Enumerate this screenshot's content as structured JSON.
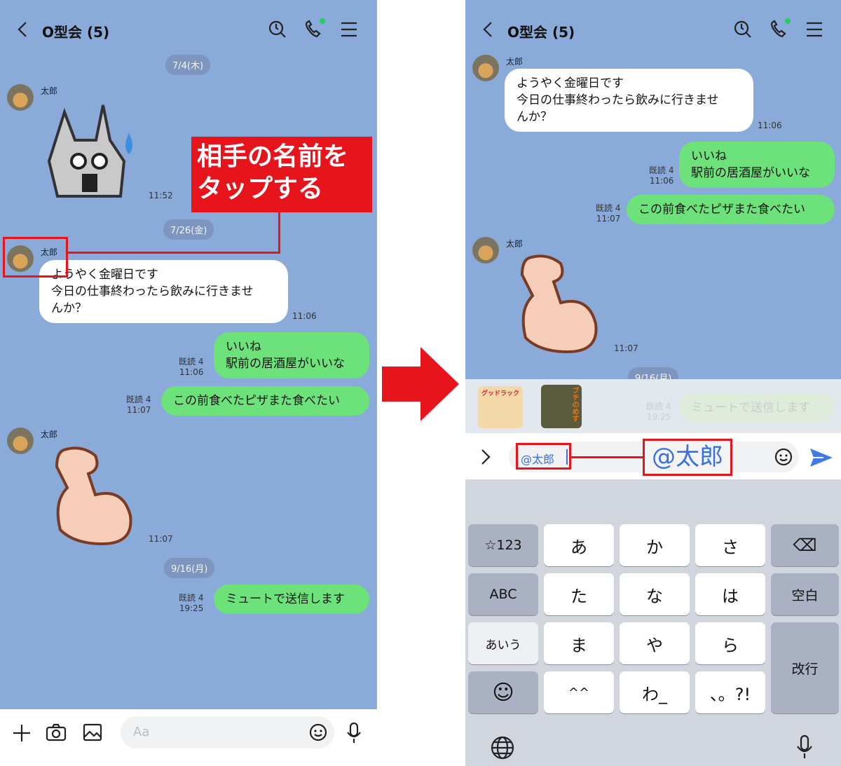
{
  "left": {
    "header": {
      "title": "O型会 (5)"
    },
    "dates": [
      "7/4(木)",
      "7/26(金)",
      "9/16(月)"
    ],
    "messages": [
      {
        "sender": "太郎",
        "type": "sticker",
        "sticker": "rabbit-shocked",
        "time": "11:52"
      },
      {
        "sender": "太郎",
        "type": "text",
        "text": [
          "ようやく金曜日です",
          "今日の仕事終わったら飲みに行きませ",
          "んか？"
        ],
        "time": "11:06"
      },
      {
        "type": "text",
        "own": true,
        "read": "既読 4",
        "text": [
          "いいね",
          "駅前の居酒屋がいいな"
        ],
        "time": "11:06"
      },
      {
        "type": "text",
        "own": true,
        "read": "既読 4",
        "text": [
          "この前食べたピザまた食べたい"
        ],
        "time": "11:07"
      },
      {
        "sender": "太郎",
        "type": "sticker",
        "sticker": "flexed-bicep",
        "time": "11:07"
      },
      {
        "type": "text",
        "own": true,
        "read": "既読 4",
        "text": [
          "ミュートで送信します"
        ],
        "time": "19:25"
      }
    ],
    "input": {
      "placeholder": "Aa"
    },
    "annotation": [
      "相手の名前を",
      "タップする"
    ]
  },
  "right": {
    "header": {
      "title": "O型会 (5)"
    },
    "messages": [
      {
        "sender": "太郎",
        "text": [
          "ようやく金曜日です",
          "今日の仕事終わったら飲みに行きませ",
          "んか？"
        ],
        "time": "11:06"
      },
      {
        "own": true,
        "read": "既読 4",
        "text": [
          "いいね",
          "駅前の居酒屋がいいな"
        ],
        "time": "11:06"
      },
      {
        "own": true,
        "read": "既読 4",
        "text": [
          "この前食べたピザまた食べたい"
        ],
        "time": "11:07"
      },
      {
        "sender": "太郎",
        "sticker": "flexed-bicep",
        "time": "11:07"
      }
    ],
    "date": "9/16(月)",
    "faded_message": {
      "read": "既読 4",
      "time": "19:25",
      "text": "ミュートで送信します"
    },
    "sticker_suggestions": [
      "グッドラック",
      "ブチのめす"
    ],
    "input": {
      "value": "@太郎"
    },
    "annotation": "@太郎",
    "keyboard": {
      "rows": [
        [
          "☆123",
          "あ",
          "か",
          "さ",
          "⌫"
        ],
        [
          "ABC",
          "た",
          "な",
          "は",
          "空白"
        ],
        [
          "あいう",
          "ま",
          "や",
          "ら"
        ],
        [
          "☺",
          "^^",
          "わ_",
          "、。?!"
        ]
      ],
      "enter": "改行"
    }
  },
  "colors": {
    "chat_bg": "#8aaad9",
    "own_bubble": "#6de27a",
    "annotation_red": "#e8141c",
    "send_blue": "#3f7be8",
    "mention_blue": "#3a6fe0"
  }
}
